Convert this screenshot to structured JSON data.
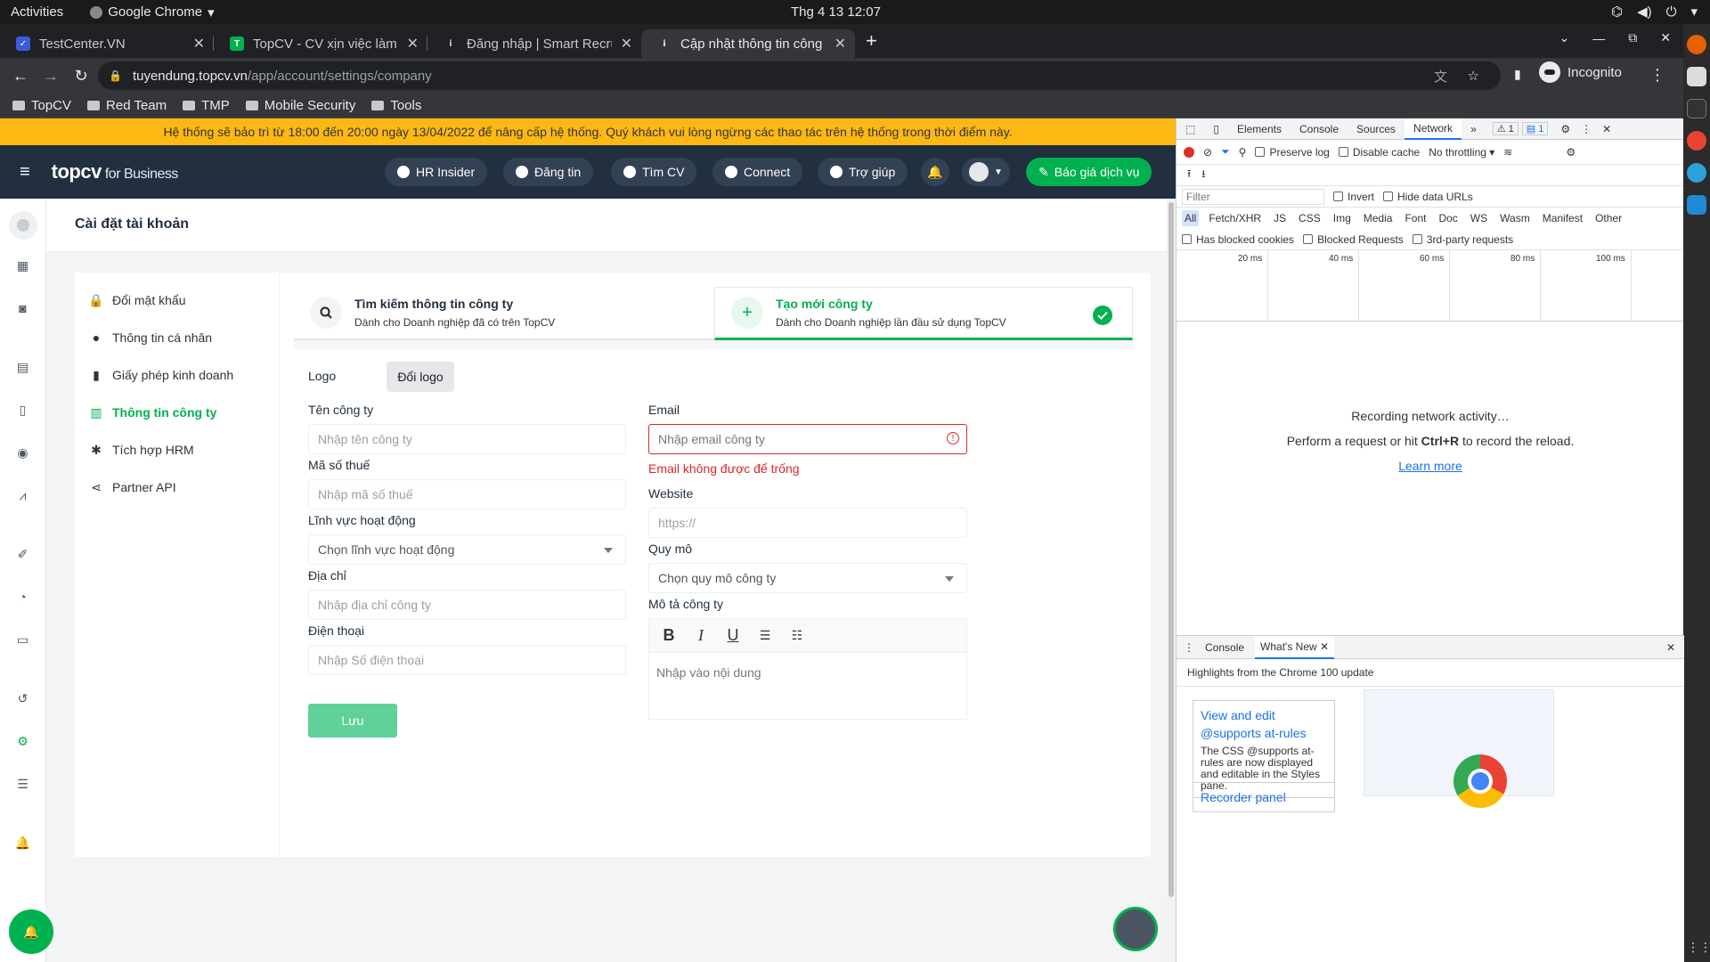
{
  "os": {
    "activities": "Activities",
    "app_name": "Google Chrome",
    "clock": "Thg 4 13  12:07"
  },
  "browser": {
    "tabs": [
      {
        "title": "TestCenter.VN",
        "active": false
      },
      {
        "title": "TopCV - CV xịn việc làm c",
        "active": false
      },
      {
        "title": "Đăng nhập | Smart Recru",
        "active": false
      },
      {
        "title": "Cập nhật thông tin công",
        "active": true
      }
    ],
    "url_host": "tuyendung.topcv.vn",
    "url_path": "/app/account/settings/company",
    "incognito_label": "Incognito",
    "bookmarks": [
      "TopCV",
      "Red Team",
      "TMP",
      "Mobile Security",
      "Tools"
    ]
  },
  "banner": {
    "text": "Hệ thống sẽ bảo trì từ 18:00 đến 20:00 ngày 13/04/2022 để nâng cấp hệ thống. Quý khách vui lòng ngừng các thao tác trên hệ thống trong thời điểm này."
  },
  "topnav": {
    "logo": "topcv",
    "logo_suffix": "for Business",
    "links": [
      "HR Insider",
      "Đăng tin",
      "Tìm CV",
      "Connect",
      "Trợ giúp"
    ],
    "quote_button": "Báo giá dịch vụ"
  },
  "page": {
    "title": "Cài đặt tài khoản"
  },
  "settings_menu": [
    {
      "label": "Đổi mật khẩu",
      "active": false
    },
    {
      "label": "Thông tin cá nhân",
      "active": false
    },
    {
      "label": "Giấy phép kinh doanh",
      "active": false
    },
    {
      "label": "Thông tin công ty",
      "active": true
    },
    {
      "label": "Tích hợp HRM",
      "active": false
    },
    {
      "label": "Partner API",
      "active": false
    }
  ],
  "choices": {
    "search": {
      "title": "Tìm kiếm thông tin công ty",
      "subtitle": "Dành cho Doanh nghiệp đã có trên TopCV"
    },
    "create": {
      "title": "Tạo mới công ty",
      "subtitle": "Dành cho Doanh nghiệp lần đầu sử dụng TopCV",
      "selected": true
    }
  },
  "form": {
    "logo_label": "Logo",
    "logo_button": "Đổi logo",
    "company_name_label": "Tên công ty",
    "company_name_placeholder": "Nhập tên công ty",
    "tax_label": "Mã số thuế",
    "tax_placeholder": "Nhập mã số thuế",
    "field_label": "Lĩnh vực hoạt động",
    "field_placeholder": "Chọn lĩnh vực hoạt động",
    "address_label": "Địa chỉ",
    "address_placeholder": "Nhập địa chỉ công ty",
    "phone_label": "Điện thoại",
    "phone_placeholder": "Nhập Số điện thoại",
    "email_label": "Email",
    "email_placeholder": "Nhập email công ty",
    "email_error": "Email không được để trống",
    "website_label": "Website",
    "website_placeholder": "https://",
    "size_label": "Quy mô",
    "size_placeholder": "Chọn quy mô công ty",
    "description_label": "Mô tả công ty",
    "description_placeholder": "Nhập vào nội dung",
    "save_button": "Lưu"
  },
  "devtools": {
    "tabs": [
      "Elements",
      "Console",
      "Sources",
      "Network"
    ],
    "active_tab": "Network",
    "warn_count": "1",
    "msg_count": "1",
    "preserve_log": "Preserve log",
    "disable_cache": "Disable cache",
    "throttling": "No throttling",
    "filter_placeholder": "Filter",
    "invert": "Invert",
    "hide_data_urls": "Hide data URLs",
    "filter_types": [
      "All",
      "Fetch/XHR",
      "JS",
      "CSS",
      "Img",
      "Media",
      "Font",
      "Doc",
      "WS",
      "Wasm",
      "Manifest",
      "Other"
    ],
    "blocked_cookies": "Has blocked cookies",
    "blocked_requests": "Blocked Requests",
    "third_party": "3rd-party requests",
    "timeline_ticks": [
      "20 ms",
      "40 ms",
      "60 ms",
      "80 ms",
      "100 ms"
    ],
    "empty_line1": "Recording network activity…",
    "empty_line2_pre": "Perform a request or hit ",
    "empty_line2_key": "Ctrl+R",
    "empty_line2_post": " to record the reload.",
    "learn_more": "Learn more",
    "drawer_tabs": [
      "Console",
      "What's New"
    ],
    "whats_new_header": "Highlights from the Chrome 100 update",
    "card1_title": "View and edit @supports at-rules",
    "card1_body": "The CSS @supports at-rules are now displayed and editable in the Styles pane.",
    "card2_title": "Recorder panel"
  },
  "colors": {
    "brand": "#00b14f",
    "banner": "#fdb813",
    "nav": "#212f3f",
    "error": "#dc2626"
  }
}
